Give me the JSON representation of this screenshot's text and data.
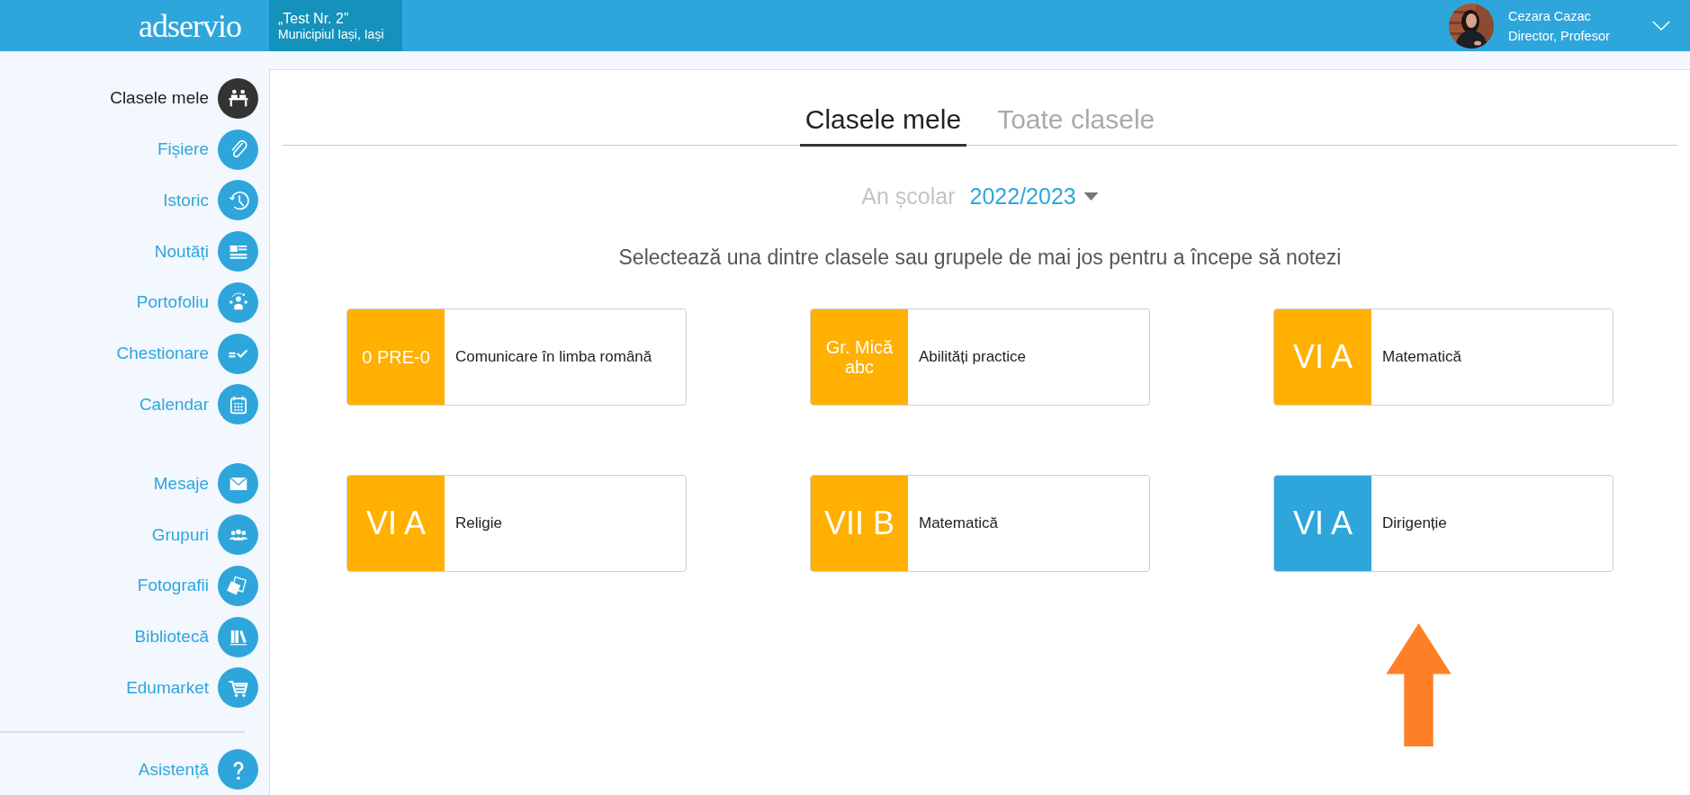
{
  "header": {
    "logo": "adservio",
    "school": {
      "name": "„Test Nr. 2”",
      "location": "Municipiul Iași, Iași"
    },
    "user": {
      "name": "Cezara Cazac",
      "role": "Director, Profesor"
    }
  },
  "sidebar": {
    "sections": [
      {
        "items": [
          {
            "label": "Clasele mele",
            "selected": true
          },
          {
            "label": "Fișiere",
            "selected": false
          },
          {
            "label": "Istoric",
            "selected": false
          },
          {
            "label": "Noutăți",
            "selected": false
          },
          {
            "label": "Portofoliu",
            "selected": false
          },
          {
            "label": "Chestionare",
            "selected": false
          },
          {
            "label": "Calendar",
            "selected": false
          }
        ]
      },
      {
        "items": [
          {
            "label": "Mesaje",
            "selected": false
          },
          {
            "label": "Grupuri",
            "selected": false
          },
          {
            "label": "Fotografii",
            "selected": false
          },
          {
            "label": "Bibliotecă",
            "selected": false
          },
          {
            "label": "Edumarket",
            "selected": false
          }
        ]
      },
      {
        "items": [
          {
            "label": "Asistență",
            "selected": false
          }
        ]
      }
    ]
  },
  "tabs": [
    {
      "label": "Clasele mele",
      "selected": true
    },
    {
      "label": "Toate clasele",
      "selected": false
    }
  ],
  "school_year": {
    "label": "An școlar",
    "value": "2022/2023"
  },
  "instruction": "Selectează una dintre clasele sau grupele de mai jos pentru a începe să notezi",
  "classes": [
    {
      "class": "0 PRE-0",
      "subject": "Comunicare în limba română",
      "color": "#ffb000"
    },
    {
      "class": "Gr. Mică abc",
      "subject": "Abilități practice",
      "color": "#ffb000"
    },
    {
      "class": "VI A",
      "subject": "Matematică",
      "color": "#ffb000"
    },
    {
      "class": "VI A",
      "subject": "Religie",
      "color": "#ffb000"
    },
    {
      "class": "VII B",
      "subject": "Matematică",
      "color": "#ffb000"
    },
    {
      "class": "VI A",
      "subject": "Dirigenție",
      "color": "#2ea6dc"
    }
  ]
}
